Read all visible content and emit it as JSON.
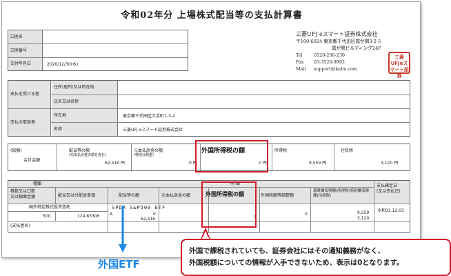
{
  "document": {
    "title": "令和02年分 上場株式配当等の支払計算書",
    "company": {
      "name": "三菱UFJ eスマート証券株式会社",
      "address1": "〒100-6024 東京都千代田区霞が関3-2-5",
      "address2": "霞が関ビルディング24F",
      "tel_label": "Tel",
      "tel": "0120-230-230",
      "fax_label": "Fax",
      "fax": "03-3520-9992",
      "mail_label": "Mail",
      "mail": "support@kabu.com"
    },
    "seal_text": "三菱UFJeスマート証券",
    "top_fields": [
      {
        "label": "口座名",
        "value": ""
      },
      {
        "label": "口座番号",
        "value": ""
      },
      {
        "label": "交付年月日",
        "value": "2020/12/30(水)"
      }
    ],
    "payee": {
      "section_label": "支払を受ける者",
      "address_label": "住所(居所)又は所在地",
      "name_label": "氏名又は名称"
    },
    "handler": {
      "section_label": "支払の取扱者",
      "address_label": "所在地",
      "address_value": "東京都千代田区大手町1-3-2",
      "name_label": "名称",
      "name_value": "三菱UFJ eスマート証券株式会社"
    },
    "summary": {
      "total_label": "(総額)",
      "total_sub": "合計金額",
      "dividend_label": "配当等の額",
      "dividend_sub": "(元本払戻金の額を含む)",
      "dividend_value": "62,416 円",
      "principal_label": "元本払戻金の額",
      "principal_sub": "(特別分配金)",
      "principal_value": "0 円",
      "foreign_tax_label": "外国所得税の額",
      "foreign_tax_value": "0 円",
      "income_tax_label": "所得税",
      "income_tax_value": "9,559 円",
      "resident_tax_label": "住民税",
      "resident_tax_value": "3,120 円"
    },
    "detail": {
      "kind_label": "種類",
      "count_label": "株数又は口数\n又は額面金額",
      "unit_label": "配当又は分配金単価",
      "dividend_label": "配当等の額",
      "principal_label": "元本払戻金の額",
      "details_label": "明 細",
      "foreign_tax_label": "外国所得税の額",
      "adj_label": "外国税額等調整額",
      "withholding_label": "源泉徴収税額(所得税)特別徴収税額(住民税)",
      "date_label": "支払確定日\n(又は支払日)",
      "row_kind": "国外特定株式投資信託",
      "fund_name": "SPDR S&P500 ETF",
      "count": "500",
      "unit": "124.83306",
      "mark": "A",
      "dividend_top": "0",
      "dividend_bottom": "62,416",
      "foreign_tax_value": "0",
      "adj_value": "0",
      "withholding_top": "9,559",
      "withholding_bottom": "3,120",
      "date_value": "令和02.12.03",
      "remarks_label": "(支払者名)"
    }
  },
  "annotations": {
    "etf_label": "外国ETF",
    "callout_line1": "外国で課税されていても、証券会社にはその通知義務がなく、",
    "callout_line2": "外国税額についての情報が入手できないため、表示は0となります。",
    "highlight_color": "#d2182a",
    "arrow_color": "#1a86e6"
  }
}
